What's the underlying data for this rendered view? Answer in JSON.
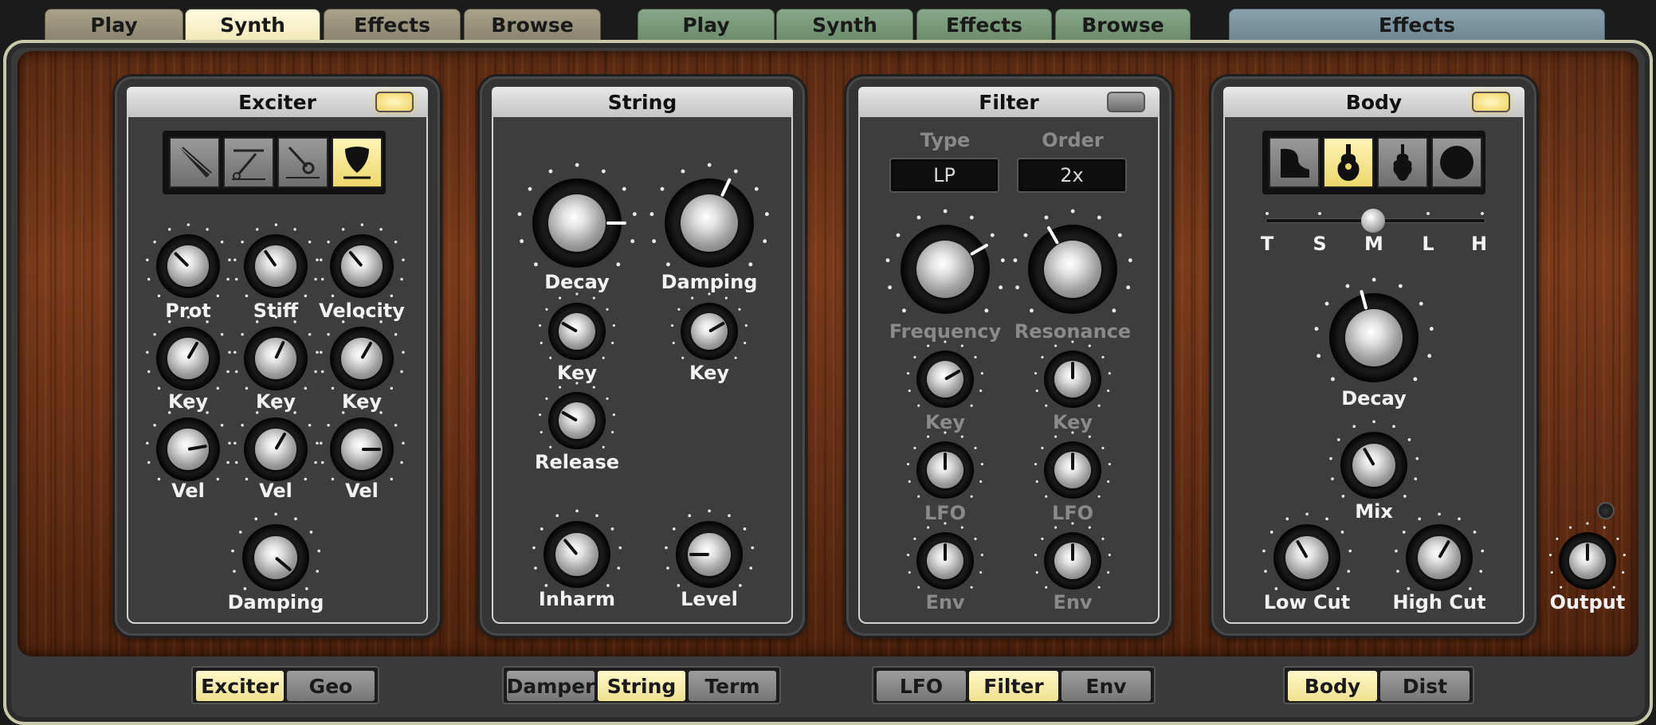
{
  "top_tabs": {
    "group1": [
      "Play",
      "Synth",
      "Effects",
      "Browse"
    ],
    "group2": [
      "Play",
      "Synth",
      "Effects",
      "Browse"
    ],
    "group3": [
      "Effects"
    ],
    "active_group1": "Synth"
  },
  "exciter": {
    "title": "Exciter",
    "led": "on",
    "types": [
      "bow-icon",
      "hammer-icon",
      "mallet-icon",
      "plectrum-icon"
    ],
    "selected_type": "plectrum-icon",
    "row1": [
      "Prot",
      "Stiff",
      "Velocity"
    ],
    "row2": [
      "Key",
      "Key",
      "Key"
    ],
    "row3": [
      "Vel",
      "Vel",
      "Vel"
    ],
    "damping": "Damping"
  },
  "string": {
    "title": "String",
    "decay": "Decay",
    "damping": "Damping",
    "key1": "Key",
    "key2": "Key",
    "release": "Release",
    "inharm": "Inharm",
    "level": "Level"
  },
  "filter": {
    "title": "Filter",
    "led": "off",
    "type_label": "Type",
    "order_label": "Order",
    "type_value": "LP",
    "order_value": "2x",
    "frequency": "Frequency",
    "resonance": "Resonance",
    "key": "Key",
    "lfo": "LFO",
    "env": "Env"
  },
  "body": {
    "title": "Body",
    "led": "on",
    "types": [
      "piano-icon",
      "guitar-icon",
      "violin-icon",
      "circle-icon"
    ],
    "selected_type": "guitar-icon",
    "sizes": [
      "T",
      "S",
      "M",
      "L",
      "H"
    ],
    "selected_size": "M",
    "decay": "Decay",
    "mix": "Mix",
    "low_cut": "Low Cut",
    "high_cut": "High Cut"
  },
  "output": "Output",
  "bottom": {
    "exciter_seg": [
      "Exciter",
      "Geo"
    ],
    "string_seg": [
      "Damper",
      "String",
      "Term"
    ],
    "filter_seg": [
      "LFO",
      "Filter",
      "Env"
    ],
    "body_seg": [
      "Body",
      "Dist"
    ]
  }
}
